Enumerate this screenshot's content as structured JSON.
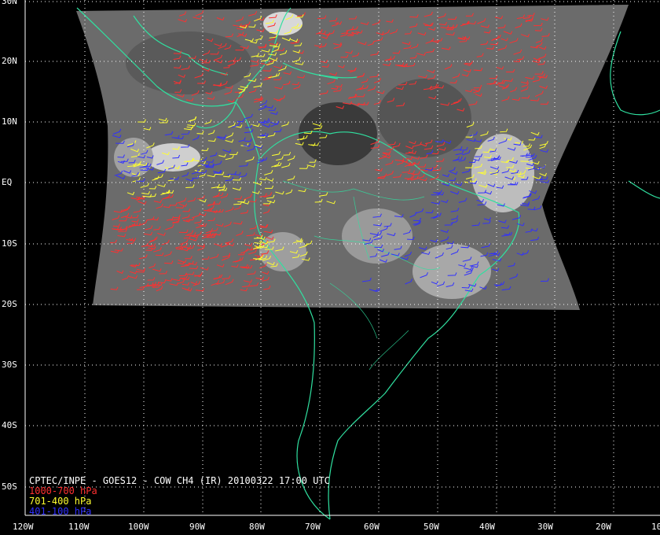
{
  "title": "CPTEC/INPE - GOES12 - COW CH4 (IR) 20100322 17:00 UTC",
  "legend": [
    {
      "label": "1000-700 hPa",
      "color": "#ff3030"
    },
    {
      "label": "701-400 hPa",
      "color": "#ffff30"
    },
    {
      "label": "401-100 hPa",
      "color": "#3030ff"
    }
  ],
  "lat_labels": [
    "30N",
    "20N",
    "10N",
    "EQ",
    "10S",
    "20S",
    "30S",
    "40S",
    "50S"
  ],
  "lon_labels": [
    "120W",
    "110W",
    "100W",
    "90W",
    "80W",
    "70W",
    "60W",
    "50W",
    "40W",
    "30W",
    "20W",
    "10"
  ],
  "colors": {
    "background": "#000000",
    "grid": "#ffffff",
    "coast": "#30e0a0",
    "cloud": "#6b6b6b"
  }
}
